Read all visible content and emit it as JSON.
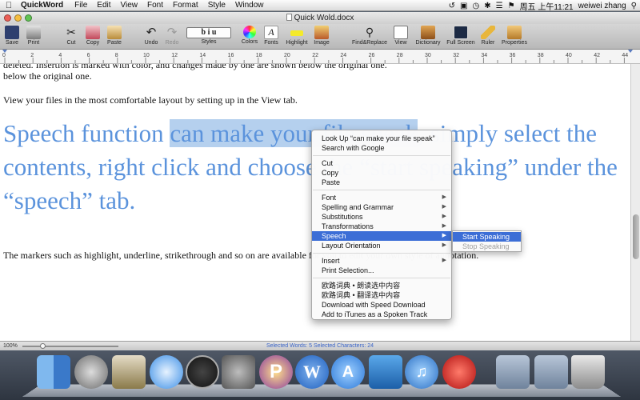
{
  "menubar": {
    "apple": "",
    "app_name": "QuickWord",
    "items": [
      "File",
      "Edit",
      "View",
      "Font",
      "Format",
      "Style",
      "Window"
    ],
    "clock": "周五 上午11:21",
    "user": "weiwei zhang"
  },
  "window": {
    "title": "Quick Wold.docx"
  },
  "toolbar": {
    "items": [
      {
        "label": "Save",
        "icon": "save-icon"
      },
      {
        "label": "Print",
        "icon": "print-icon"
      },
      {
        "label": "Cut",
        "icon": "cut-icon"
      },
      {
        "label": "Copy",
        "icon": "copy-icon"
      },
      {
        "label": "Paste",
        "icon": "paste-icon"
      },
      {
        "label": "Undo",
        "icon": "undo-icon"
      },
      {
        "label": "Redo",
        "icon": "redo-icon"
      },
      {
        "label": "Styles",
        "icon": "styles-icon",
        "glyph": "b i u"
      },
      {
        "label": "Colors",
        "icon": "colors-icon"
      },
      {
        "label": "Fonts",
        "icon": "fonts-icon"
      },
      {
        "label": "Highlight",
        "icon": "highlight-icon"
      },
      {
        "label": "Image",
        "icon": "image-icon"
      },
      {
        "label": "Find&Replace",
        "icon": "find-replace-icon"
      },
      {
        "label": "View",
        "icon": "view-icon"
      },
      {
        "label": "Dictionary",
        "icon": "dictionary-icon"
      },
      {
        "label": "Full Screen",
        "icon": "full-screen-icon"
      },
      {
        "label": "Ruler",
        "icon": "ruler-icon"
      },
      {
        "label": "Properties",
        "icon": "properties-icon"
      }
    ]
  },
  "ruler": {
    "ticks": [
      "0",
      "2",
      "4",
      "6",
      "8",
      "10",
      "12",
      "14",
      "16",
      "18",
      "20",
      "22",
      "24",
      "26",
      "28",
      "30",
      "32",
      "34",
      "36",
      "38",
      "40",
      "42",
      "44"
    ]
  },
  "document": {
    "cut_line": "deleted. Insertion is marked with color, and changes made by one are shown below the original one.",
    "line2": "below the original one.",
    "line3": "View your files in the most comfortable layout by setting up in the View tab.",
    "big_before": "Speech function ",
    "big_selected": "can make your file speak",
    "big_after": ", simply select the contents, right click and choose the “start speaking” under the “speech” tab.",
    "line4": "The markers such as highlight, underline, strikethrough and so on are available for you to edit your own style of annotation."
  },
  "status": {
    "zoom": "100%",
    "selection": "Selected Words: 5  Selected Characters: 24"
  },
  "context_menu": {
    "items": [
      {
        "label": "Look Up “can make your file speak”"
      },
      {
        "label": "Search with Google"
      },
      {
        "label": "Cut"
      },
      {
        "label": "Copy"
      },
      {
        "label": "Paste"
      },
      {
        "label": "Font",
        "submenu": true
      },
      {
        "label": "Spelling and Grammar",
        "submenu": true
      },
      {
        "label": "Substitutions",
        "submenu": true
      },
      {
        "label": "Transformations",
        "submenu": true
      },
      {
        "label": "Speech",
        "submenu": true,
        "active": true
      },
      {
        "label": "Layout Orientation",
        "submenu": true
      },
      {
        "label": "Insert",
        "submenu": true
      },
      {
        "label": "Print Selection..."
      },
      {
        "label": "欧路词典 • 朗读选中内容"
      },
      {
        "label": "欧路词典 • 翻译选中内容"
      },
      {
        "label": "Download with Speed Download"
      },
      {
        "label": "Add to iTunes as a Spoken Track"
      }
    ],
    "arrow": "▶"
  },
  "speech_submenu": {
    "start": "Start Speaking",
    "stop": "Stop Speaking"
  },
  "dock": {
    "apps": [
      {
        "name": "finder-icon"
      },
      {
        "name": "launchpad-icon"
      },
      {
        "name": "mail-icon"
      },
      {
        "name": "safari-icon"
      },
      {
        "name": "dashboard-icon"
      },
      {
        "name": "system-preferences-icon"
      },
      {
        "name": "p-app-icon",
        "glyph": "P"
      },
      {
        "name": "word-icon",
        "glyph": "W"
      },
      {
        "name": "app-store-icon",
        "glyph": "A"
      },
      {
        "name": "dropbox-icon"
      },
      {
        "name": "itunes-icon",
        "glyph": "♫"
      },
      {
        "name": "acrobat-icon"
      },
      {
        "name": "applications-folder-icon"
      },
      {
        "name": "documents-folder-icon"
      },
      {
        "name": "trash-icon"
      }
    ]
  },
  "colors": {
    "accent": "#3c6ed6",
    "doc_blue_text": "#5b93dc",
    "selection_bg": "#b5d0ee"
  }
}
